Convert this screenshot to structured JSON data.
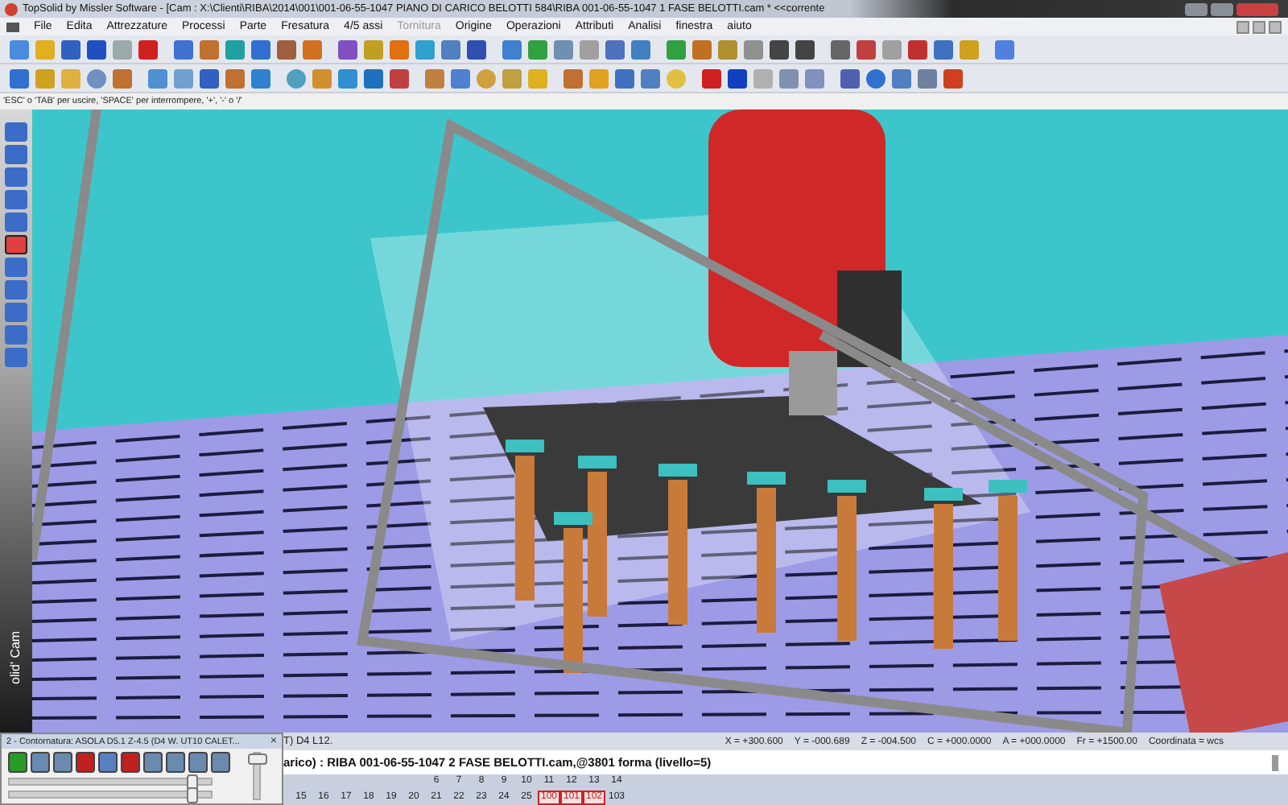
{
  "window": {
    "title": "TopSolid by Missler Software - [Cam : X:\\Clienti\\RIBA\\2014\\001\\001-06-55-1047 PIANO DI CARICO BELOTTI 584\\RIBA 001-06-55-1047 1 FASE BELOTTI.cam * <<corrente"
  },
  "menu": [
    {
      "label": "File",
      "disabled": false
    },
    {
      "label": "Edita",
      "disabled": false
    },
    {
      "label": "Attrezzature",
      "disabled": false
    },
    {
      "label": "Processi",
      "disabled": false
    },
    {
      "label": "Parte",
      "disabled": false
    },
    {
      "label": "Fresatura",
      "disabled": false
    },
    {
      "label": "4/5 assi",
      "disabled": false
    },
    {
      "label": "Tornitura",
      "disabled": true
    },
    {
      "label": "Origine",
      "disabled": false
    },
    {
      "label": "Operazioni",
      "disabled": false
    },
    {
      "label": "Attributi",
      "disabled": false
    },
    {
      "label": "Analisi",
      "disabled": false
    },
    {
      "label": "finestra",
      "disabled": false
    },
    {
      "label": "aiuto",
      "disabled": false
    }
  ],
  "hint": "'ESC' o 'TAB' per uscire, 'SPACE' per interrompere, '+', '-' o '/'",
  "side_tools": [
    {
      "selected": false
    },
    {
      "selected": false
    },
    {
      "selected": false
    },
    {
      "selected": false
    },
    {
      "selected": false
    },
    {
      "selected": true
    },
    {
      "selected": false
    },
    {
      "selected": false
    },
    {
      "selected": false
    },
    {
      "selected": false
    },
    {
      "selected": false
    }
  ],
  "side_label": "olid' Cam",
  "coordinates": [
    "X = +300.600",
    "Y = -000.689",
    "Z = -004.500",
    "C = +000.0000",
    "A = +000.0000",
    "Fr = +1500.00",
    "Coordinata = wcs"
  ],
  "command": {
    "previous_line": "T) D4 L12.",
    "current_line": "arico)  : RIBA 001-06-55-1047 2 FASE BELOTTI.cam,@3801 forma (livello=5)"
  },
  "numbers": {
    "row_1": [
      {
        "label": "6",
        "marked": false
      },
      {
        "label": "7",
        "marked": false
      },
      {
        "label": "8",
        "marked": false
      },
      {
        "label": "9",
        "marked": false
      },
      {
        "label": "10",
        "marked": false
      },
      {
        "label": "11",
        "marked": false
      },
      {
        "label": "12",
        "marked": false
      },
      {
        "label": "13",
        "marked": false
      },
      {
        "label": "14",
        "marked": false
      }
    ],
    "row_2": [
      {
        "label": "15",
        "marked": false
      },
      {
        "label": "16",
        "marked": false
      },
      {
        "label": "17",
        "marked": false
      },
      {
        "label": "18",
        "marked": false
      },
      {
        "label": "19",
        "marked": false
      },
      {
        "label": "20",
        "marked": false
      },
      {
        "label": "21",
        "marked": false
      },
      {
        "label": "22",
        "marked": false
      },
      {
        "label": "23",
        "marked": false
      },
      {
        "label": "24",
        "marked": false
      },
      {
        "label": "25",
        "marked": false
      },
      {
        "label": "100",
        "marked": true
      },
      {
        "label": "101",
        "marked": true
      },
      {
        "label": "102",
        "marked": true
      },
      {
        "label": "103",
        "marked": false
      }
    ]
  },
  "sim_panel": {
    "title": "2 - Contornatura: ASOLA D5.1 Z-4.5   (D4 W. UT10 CALET...",
    "close": "×",
    "sliders": [
      {
        "level": 0.9
      },
      {
        "level": 0.9
      }
    ],
    "vertical_slider": {
      "level": 1
    }
  }
}
